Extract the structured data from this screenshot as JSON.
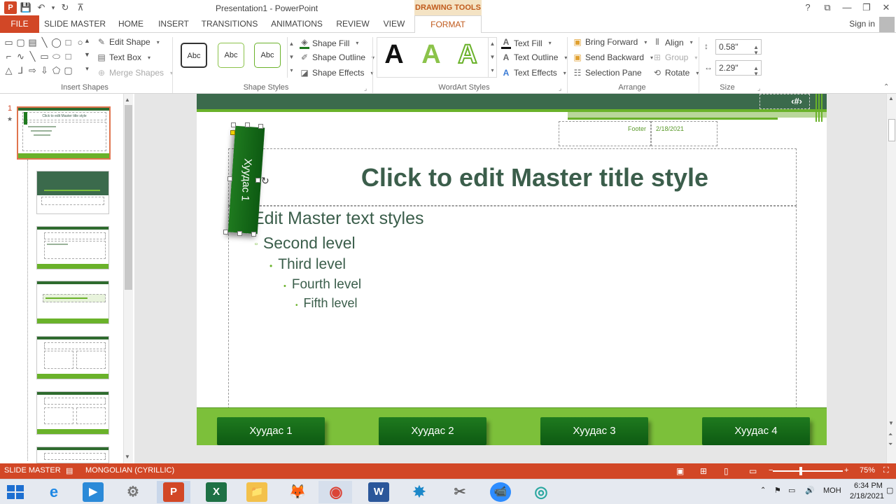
{
  "window": {
    "title": "Presentation1 - PowerPoint",
    "context_tab": "DRAWING TOOLS",
    "help": "?",
    "minimize": "—",
    "restore": "❐",
    "close": "✕",
    "ribbon_display": "⧉"
  },
  "qat": {
    "logo": "P",
    "save": "💾",
    "undo": "↶",
    "undo_more": "▾",
    "redo": "↻",
    "customize": "⊼"
  },
  "tabs": [
    "FILE",
    "SLIDE MASTER",
    "HOME",
    "INSERT",
    "TRANSITIONS",
    "ANIMATIONS",
    "REVIEW",
    "VIEW",
    "FORMAT"
  ],
  "signin": "Sign in",
  "ribbon": {
    "insert_shapes": {
      "label": "Insert Shapes",
      "edit_shape": "Edit Shape",
      "text_box": "Text Box",
      "merge_shapes": "Merge Shapes"
    },
    "shape_styles": {
      "label": "Shape Styles",
      "presets": [
        "Abc",
        "Abc",
        "Abc"
      ],
      "shape_fill": "Shape Fill",
      "shape_outline": "Shape Outline",
      "shape_effects": "Shape Effects"
    },
    "wordart": {
      "label": "WordArt Styles",
      "samples": [
        "A",
        "A",
        "A"
      ],
      "text_fill": "Text Fill",
      "text_outline": "Text Outline",
      "text_effects": "Text Effects"
    },
    "arrange": {
      "label": "Arrange",
      "bring_forward": "Bring Forward",
      "send_backward": "Send Backward",
      "selection_pane": "Selection Pane",
      "align": "Align",
      "group": "Group",
      "rotate": "Rotate"
    },
    "size": {
      "label": "Size",
      "height": "0.58\"",
      "width": "2.29\""
    }
  },
  "thumbnails": {
    "selected_number": "1",
    "star": "★",
    "mini_title": "Click to edit Master title style"
  },
  "slide": {
    "slide_number": "‹#›",
    "footer": "Footer",
    "date": "2/18/2021",
    "title": "Click to edit Master title style",
    "levels": [
      "Edit Master text styles",
      "Second level",
      "Third level",
      "Fourth level",
      "Fifth level"
    ],
    "rotated_button": "Хуудас 1",
    "nav_buttons": [
      "Хуудас 1",
      "Хуудас 2",
      "Хуудас 3",
      "Хуудас 4"
    ]
  },
  "statusbar": {
    "mode": "SLIDE MASTER",
    "language": "MONGOLIAN (CYRILLIC)",
    "zoom": "75%"
  },
  "taskbar": {
    "lang": "МОН",
    "time": "6:34 PM",
    "date": "2/18/2021",
    "apps": [
      "e",
      "▶",
      "⚙",
      "P",
      "X",
      "📁",
      "🦊",
      "◉",
      "W",
      "✸",
      "✂",
      "📹",
      "◎"
    ]
  },
  "colors": {
    "accent": "#d24726",
    "green_dark": "#0d5a12",
    "green_light": "#7cc03a",
    "title_text": "#3b5e4b"
  }
}
